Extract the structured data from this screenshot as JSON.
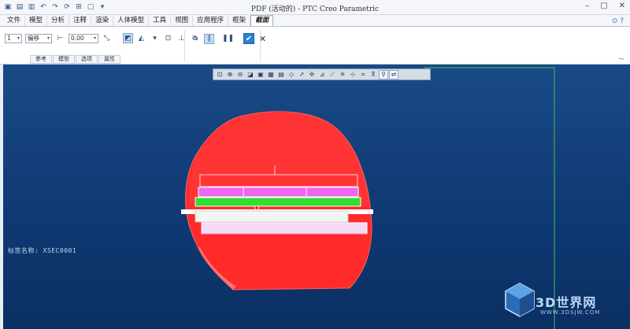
{
  "window": {
    "title": "PDF (活动的) - PTC Creo Parametric",
    "quick_access_icons": [
      "new-icon",
      "open-icon",
      "save-icon",
      "undo-icon",
      "redo-icon",
      "regenerate-icon",
      "windows-icon",
      "close-window-icon"
    ]
  },
  "menu_tabs": [
    "文件",
    "模型",
    "分析",
    "注释",
    "渲染",
    "人体模型",
    "工具",
    "视图",
    "应用程序",
    "框架",
    "截面"
  ],
  "active_tab": "截面",
  "ribbon": {
    "count_value": "1",
    "offset_mode": "偏移",
    "offset_value": "0.00",
    "sub_tabs": [
      "参考",
      "模型",
      "选项",
      "属性"
    ]
  },
  "viewport": {
    "section_name_label": "标签名称: XSEC0001",
    "toolbar_icons": [
      "refit-icon",
      "zoom-in-icon",
      "zoom-out-icon",
      "repaint-icon",
      "shading-icon",
      "view-manager-icon",
      "saved-views-icon",
      "plane-display-icon",
      "axis-display-icon",
      "point-display-icon",
      "csys-display-icon",
      "annotation-display-icon",
      "spin-center-icon",
      "select-icon",
      "section-icon",
      "measure-icon",
      "cut-icon",
      "active-tool-icon"
    ]
  },
  "watermark": {
    "text": "3D世界网",
    "url": "WWW.3DSJW.COM"
  },
  "colors": {
    "viewport_bg": "#1a4a86",
    "shell_red": "#ff2222",
    "magenta_layer": "#ee66ee",
    "green_layer": "#33dd33",
    "pink_layer": "#f2d8f2"
  }
}
